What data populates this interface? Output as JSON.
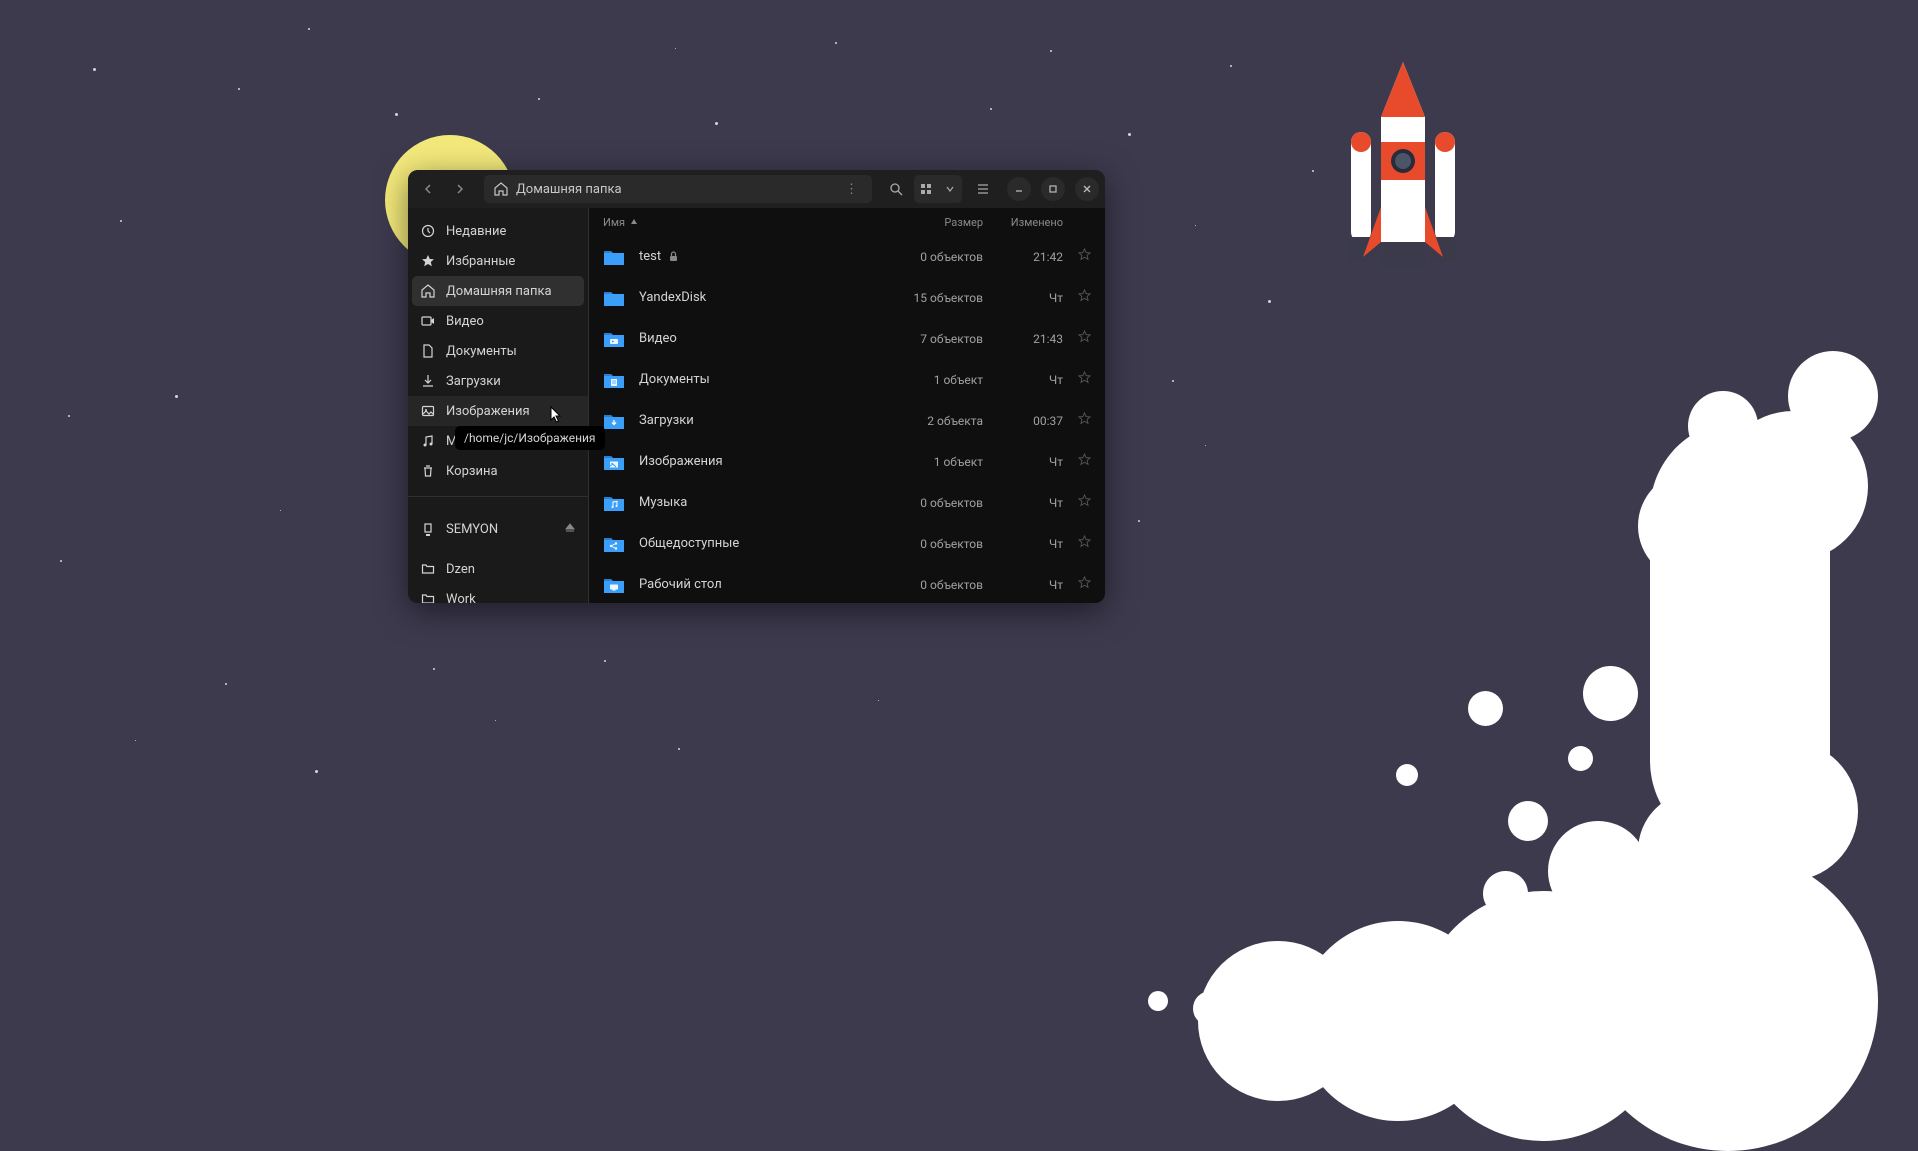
{
  "window": {
    "pathbar_label": "Домашняя папка"
  },
  "sidebar": {
    "items": [
      {
        "label": "Недавние",
        "icon": "clock"
      },
      {
        "label": "Избранные",
        "icon": "star"
      },
      {
        "label": "Домашняя папка",
        "icon": "home",
        "active": true
      },
      {
        "label": "Видео",
        "icon": "video"
      },
      {
        "label": "Документы",
        "icon": "document"
      },
      {
        "label": "Загрузки",
        "icon": "download"
      },
      {
        "label": "Изображения",
        "icon": "image"
      },
      {
        "label": "Музыка",
        "icon": "music"
      },
      {
        "label": "Корзина",
        "icon": "trash"
      }
    ],
    "device": {
      "label": "SEMYON"
    },
    "bookmarks": [
      {
        "label": "Dzen"
      },
      {
        "label": "Work"
      }
    ]
  },
  "columns": {
    "name": "Имя",
    "size": "Размер",
    "modified": "Изменено"
  },
  "files": [
    {
      "name": "test",
      "locked": true,
      "size": "0 объектов",
      "modified": "21:42",
      "type": "folder"
    },
    {
      "name": "YandexDisk",
      "size": "15 объектов",
      "modified": "Чт",
      "type": "folder"
    },
    {
      "name": "Видео",
      "size": "7 объектов",
      "modified": "21:43",
      "type": "video"
    },
    {
      "name": "Документы",
      "size": "1 объект",
      "modified": "Чт",
      "type": "document"
    },
    {
      "name": "Загрузки",
      "size": "2 объекта",
      "modified": "00:37",
      "type": "download"
    },
    {
      "name": "Изображения",
      "size": "1 объект",
      "modified": "Чт",
      "type": "image"
    },
    {
      "name": "Музыка",
      "size": "0 объектов",
      "modified": "Чт",
      "type": "music"
    },
    {
      "name": "Общедоступные",
      "size": "0 объектов",
      "modified": "Чт",
      "type": "share"
    },
    {
      "name": "Рабочий стол",
      "size": "0 объектов",
      "modified": "Чт",
      "type": "desktop"
    }
  ],
  "tooltip": "/home/jc/Изображения"
}
